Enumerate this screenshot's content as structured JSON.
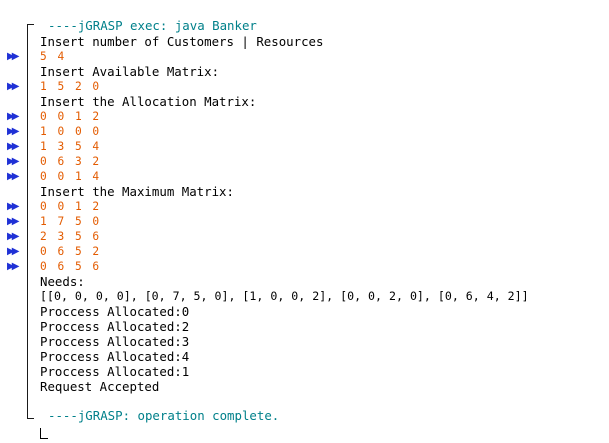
{
  "console": {
    "header": "----jGRASP exec: java Banker",
    "footer": "----jGRASP: operation complete.",
    "input_marker": "▶▶",
    "colors": {
      "system": "#00808a",
      "output": "#000000",
      "input": "#e35b00",
      "marker": "#1f31d6"
    },
    "lines": [
      "Insert number of Customers | Resources",
      "5 4",
      "Insert Available Matrix:",
      "1 5 2 0",
      "Insert the Allocation Matrix:",
      "0 0 1 2",
      "1 0 0 0",
      "1 3 5 4",
      "0 6 3 2",
      "0 0 1 4",
      "Insert the Maximum Matrix:",
      "0 0 1 2",
      "1 7 5 0",
      "2 3 5 6",
      "0 6 5 2",
      "0 6 5 6",
      "Needs:",
      "[[0, 0, 0, 0], [0, 7, 5, 0], [1, 0, 0, 2], [0, 0, 2, 0], [0, 6, 4, 2]]",
      "Proccess Allocated:0",
      "Proccess Allocated:2",
      "Proccess Allocated:3",
      "Proccess Allocated:4",
      "Proccess Allocated:1",
      "Request Accepted"
    ]
  }
}
